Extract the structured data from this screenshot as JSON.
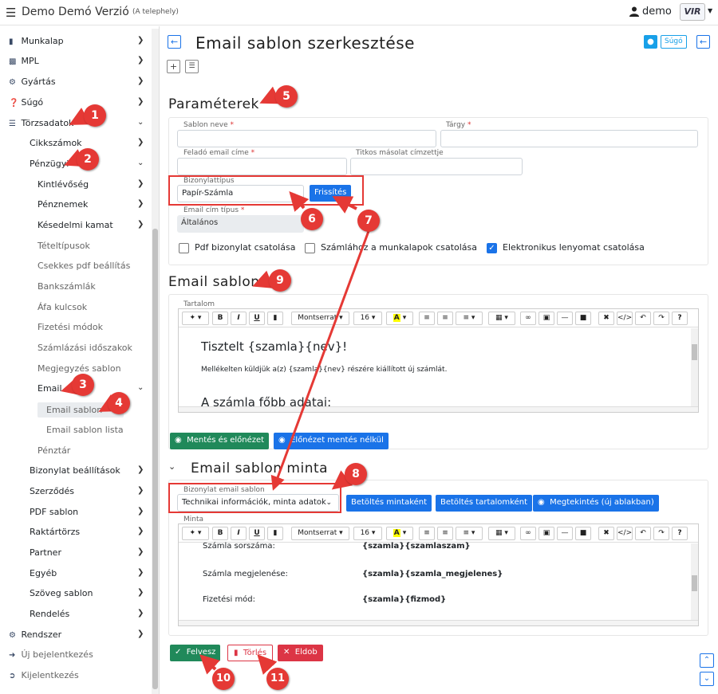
{
  "topbar": {
    "app_title": "Demo Demó Verzió",
    "site": "(A telephely)",
    "user": "demo",
    "logo": "VIR"
  },
  "sidebar": {
    "munkalap": "Munkalap",
    "mpl": "MPL",
    "gyartas": "Gyártás",
    "sugo": "Súgó",
    "torzsadatok": "Törzsadatok",
    "cikkszamok": "Cikkszámok",
    "penzugyi": "Pénzügyi",
    "kintlevoseg": "Kintlévőség",
    "penznemek": "Pénznemek",
    "kesedelmi": "Késedelmi kamat",
    "tetel": "Tételtípusok",
    "csekkes": "Csekkes pdf beállítás",
    "bank": "Bankszámlák",
    "afa": "Áfa kulcsok",
    "fizetesi": "Fizetési módok",
    "szamlazasi": "Számlázási időszakok",
    "megjegyzes": "Megjegyzés sablon",
    "email": "Email",
    "email_sablon": "Email sablon",
    "email_sablon_lista": "Email sablon lista",
    "penztar": "Pénztár",
    "bizonylat_beall": "Bizonylat beállítások",
    "szerzodes": "Szerződés",
    "pdf_sablon": "PDF sablon",
    "raktar": "Raktártörzs",
    "partner": "Partner",
    "egyeb": "Egyéb",
    "szoveg_sablon": "Szöveg sablon",
    "rendeles": "Rendelés",
    "rendszer": "Rendszer",
    "uj_bejel": "Új bejelentkezés",
    "kijel": "Kijelentkezés"
  },
  "main": {
    "page_title": "Email sablon szerkesztése",
    "sugo_btn": "Súgó",
    "params_title": "Paraméterek",
    "sablon_neve": "Sablon neve",
    "targy": "Tárgy",
    "felado": "Feladó email címe",
    "titkos": "Titkos másolat címzettje",
    "bizonylattipus": "Bizonylattípus",
    "bizonylattipus_value": "Papír-Számla",
    "frissites": "Frissítés",
    "email_cim_tipus": "Email cím típus",
    "email_cim_tipus_value": "Általános",
    "cb_pdf": "Pdf bizonylat csatolása",
    "cb_munkalap": "Számlához a munkalapok csatolása",
    "cb_elek": "Elektronikus lenyomat csatolása",
    "email_sablon_title": "Email sablon",
    "tartalom": "Tartalom",
    "font_name": "Montserrat",
    "font_size": "16",
    "ed1_line1": "Tisztelt {szamla}{nev}!",
    "ed1_line2": "Mellékelten küldjük a(z) {szamla}{nev} részére kiállított új számlát.",
    "ed1_line3": "A számla főbb adatai:",
    "mentes_elonezet": "Mentés és előnézet",
    "elonezet_nelkul": "Előnézet mentés nélkül",
    "minta_title": "Email sablon minta",
    "biz_email_sablon": "Bizonylat email sablon",
    "biz_email_value": "Technikai információk, minta adatok",
    "betoltes_minta": "Betöltés mintaként",
    "betoltes_tartalom": "Betöltés tartalomként",
    "megtekintes": "Megtekintés (új ablakban)",
    "minta": "Minta",
    "ed2_row0_l": "Számla sorszáma:",
    "ed2_row0_r": "{szamla}{szamlaszam}",
    "ed2_row1_l": "Számla megjelenése:",
    "ed2_row1_r": "{szamla}{szamla_megjelenes}",
    "ed2_row2_l": "Fizetési mód:",
    "ed2_row2_r": "{szamla}{fizmod}",
    "felvesz": "Felvesz",
    "torles": "Törlés",
    "eldob": "Eldob"
  },
  "badges": [
    "1",
    "2",
    "3",
    "4",
    "5",
    "6",
    "7",
    "8",
    "9",
    "10",
    "11"
  ],
  "colors": {
    "accent": "#1a73e8",
    "success": "#20895a",
    "danger": "#dc3545",
    "annotation": "#e53935"
  }
}
